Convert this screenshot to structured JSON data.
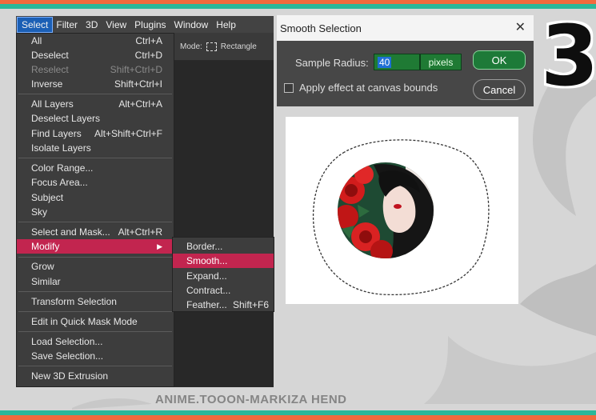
{
  "menubar": {
    "items": [
      {
        "label": "Select",
        "active": true
      },
      {
        "label": "Filter"
      },
      {
        "label": "3D"
      },
      {
        "label": "View"
      },
      {
        "label": "Plugins"
      },
      {
        "label": "Window"
      },
      {
        "label": "Help"
      }
    ]
  },
  "options_bar": {
    "mode_label": "Mode:",
    "mode_value": "Rectangle"
  },
  "select_menu": {
    "groups": [
      [
        {
          "label": "All",
          "shortcut": "Ctrl+A"
        },
        {
          "label": "Deselect",
          "shortcut": "Ctrl+D"
        },
        {
          "label": "Reselect",
          "shortcut": "Shift+Ctrl+D",
          "disabled": true
        },
        {
          "label": "Inverse",
          "shortcut": "Shift+Ctrl+I"
        }
      ],
      [
        {
          "label": "All Layers",
          "shortcut": "Alt+Ctrl+A"
        },
        {
          "label": "Deselect Layers",
          "shortcut": ""
        },
        {
          "label": "Find Layers",
          "shortcut": "Alt+Shift+Ctrl+F"
        },
        {
          "label": "Isolate Layers",
          "shortcut": ""
        }
      ],
      [
        {
          "label": "Color Range...",
          "shortcut": ""
        },
        {
          "label": "Focus Area...",
          "shortcut": ""
        },
        {
          "label": "Subject",
          "shortcut": ""
        },
        {
          "label": "Sky",
          "shortcut": ""
        }
      ],
      [
        {
          "label": "Select and Mask...",
          "shortcut": "Alt+Ctrl+R"
        },
        {
          "label": "Modify",
          "shortcut": "",
          "submenu": true,
          "highlighted": true
        }
      ],
      [
        {
          "label": "Grow",
          "shortcut": ""
        },
        {
          "label": "Similar",
          "shortcut": ""
        }
      ],
      [
        {
          "label": "Transform Selection",
          "shortcut": ""
        }
      ],
      [
        {
          "label": "Edit in Quick Mask Mode",
          "shortcut": ""
        }
      ],
      [
        {
          "label": "Load Selection...",
          "shortcut": ""
        },
        {
          "label": "Save Selection...",
          "shortcut": ""
        }
      ],
      [
        {
          "label": "New 3D Extrusion",
          "shortcut": ""
        }
      ]
    ]
  },
  "modify_submenu": {
    "items": [
      {
        "label": "Border...",
        "shortcut": ""
      },
      {
        "label": "Smooth...",
        "shortcut": "",
        "highlighted": true
      },
      {
        "label": "Expand...",
        "shortcut": ""
      },
      {
        "label": "Contract...",
        "shortcut": ""
      },
      {
        "label": "Feather...",
        "shortcut": "Shift+F6"
      }
    ]
  },
  "dialog": {
    "title": "Smooth Selection",
    "sample_radius_label": "Sample Radius:",
    "sample_radius_value": "40",
    "unit": "pixels",
    "apply_bounds_label": "Apply effect at canvas bounds",
    "apply_bounds_checked": false,
    "ok_label": "OK",
    "cancel_label": "Cancel"
  },
  "step_number": "3",
  "watermark": "ANIME.TOOON-MARKIZA HEND",
  "colors": {
    "top_stripe_orange": "#f26a3d",
    "top_stripe_teal": "#2bb89a",
    "menu_highlight": "#c2254f",
    "field_green": "#1f7a34",
    "background": "#d6d6d6"
  }
}
